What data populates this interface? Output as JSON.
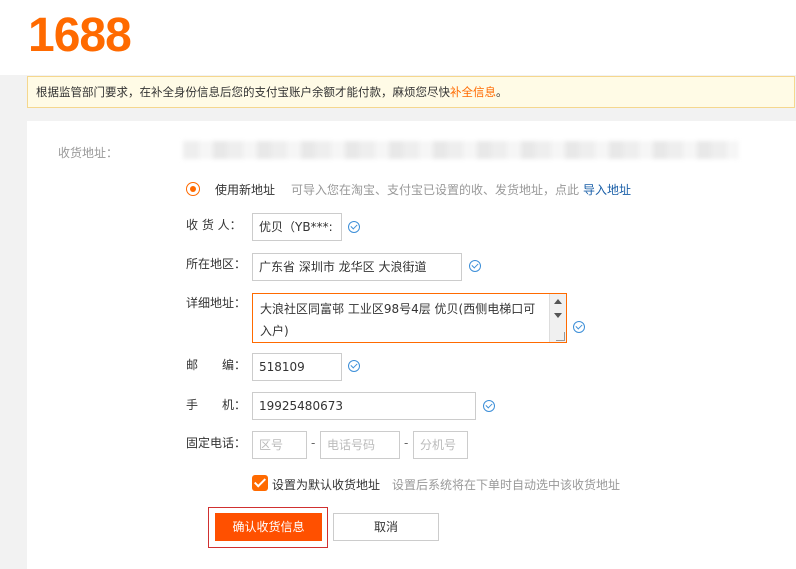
{
  "header": {
    "logo": "1688"
  },
  "notice": {
    "text": "根据监管部门要求，在补全身份信息后您的支付宝账户余额才能付款，麻烦您尽快",
    "link": "补全信息",
    "suffix": "。"
  },
  "form": {
    "address_label": "收货地址：",
    "use_new_label": "使用新地址",
    "import_hint": "可导入您在淘宝、支付宝已设置的收、发货地址，点此",
    "import_link": "导入地址",
    "receiver": {
      "label": "收 货 人：",
      "value": "优贝（YB***:"
    },
    "region": {
      "label": "所在地区：",
      "value": "广东省 深圳市 龙华区 大浪街道"
    },
    "detail": {
      "label": "详细地址：",
      "value": "大浪社区同富邨 工业区98号4层 优贝(西侧电梯口可入户)"
    },
    "postcode": {
      "label": "邮　　编：",
      "value": "518109"
    },
    "mobile": {
      "label": "手　　机：",
      "value": "19925480673"
    },
    "phone": {
      "label": "固定电话：",
      "area_placeholder": "区号",
      "number_placeholder": "电话号码",
      "ext_placeholder": "分机号",
      "separator": "-"
    },
    "default_label": "设置为默认收货地址",
    "default_hint": "设置后系统将在下单时自动选中该收货地址",
    "confirm_button": "确认收货信息",
    "cancel_button": "取消"
  },
  "colors": {
    "accent": "#ff6a00",
    "link": "#1a5fa8",
    "check": "#3d8fd8"
  }
}
